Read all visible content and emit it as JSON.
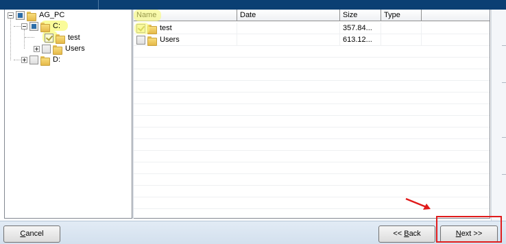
{
  "tree": {
    "root": {
      "label": "AG_PC",
      "state": "partial"
    },
    "items": [
      {
        "label": "C:",
        "state": "partial"
      },
      {
        "label": "test",
        "state": "checked"
      },
      {
        "label": "Users",
        "state": "unchecked"
      },
      {
        "label": "D:",
        "state": "unchecked"
      }
    ]
  },
  "file_list": {
    "columns": [
      "Name",
      "Date",
      "Size",
      "Type"
    ],
    "rows": [
      {
        "name": "test",
        "date": "",
        "size": "357.84...",
        "type": "",
        "state": "checked"
      },
      {
        "name": "Users",
        "date": "",
        "size": "613.12...",
        "type": "",
        "state": "unchecked"
      }
    ]
  },
  "buttons": {
    "cancel": {
      "label_underlined": "C",
      "label_rest": "ancel"
    },
    "back": {
      "label_prefix": "<< ",
      "label_underlined": "B",
      "label_rest": "ack"
    },
    "next": {
      "label_underlined": "N",
      "label_rest": "ext >>"
    }
  },
  "annotations": {
    "highlight_color": "#f8fa78",
    "callout_color": "#e01b1b"
  },
  "icons": {
    "tree_expander_open": "minus-box-icon",
    "tree_expander_closed": "plus-box-icon",
    "folder": "folder-icon",
    "checkbox": "checkbox-icon"
  }
}
